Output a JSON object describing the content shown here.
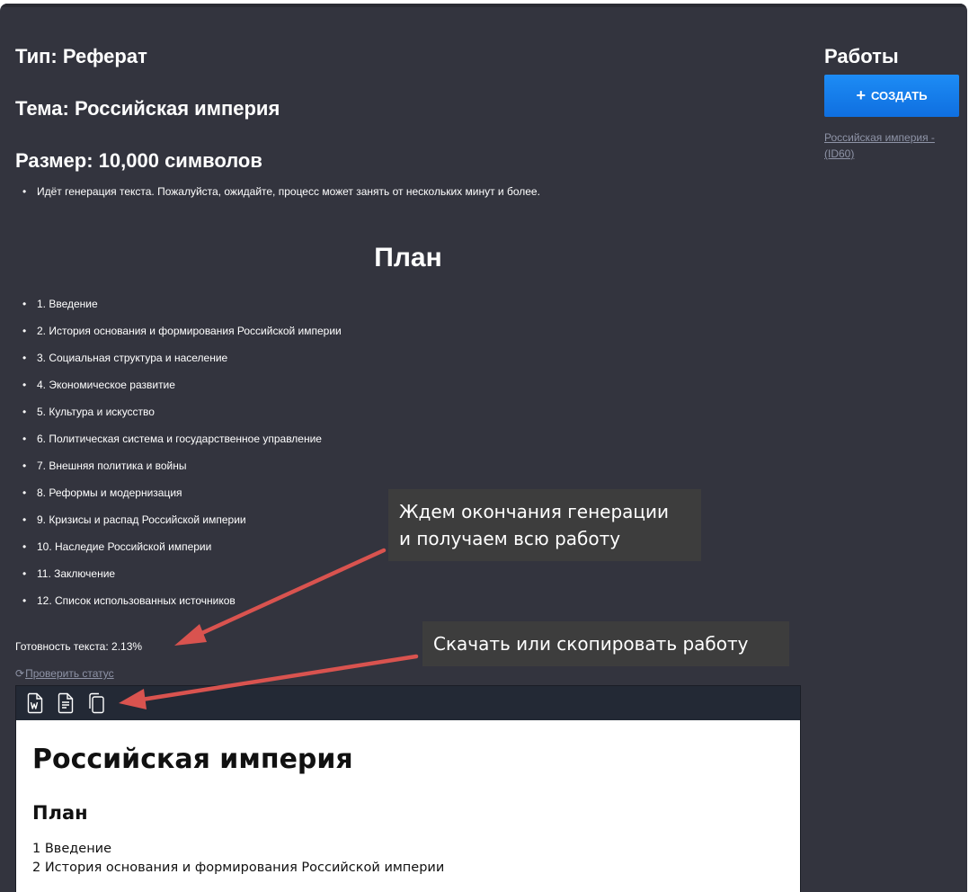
{
  "main": {
    "type_heading": "Тип: Реферат",
    "topic_heading": "Тема: Российская империя",
    "size_heading": "Размер: 10,000 символов",
    "notice": "Идёт генерация текста. Пожалуйста, ожидайте, процесс может занять от нескольких минут и более.",
    "plan_heading": "План",
    "plan_items": [
      "1. Введение",
      "2. История основания и формирования Российской империи",
      "3. Социальная структура и население",
      "4. Экономическое развитие",
      "5. Культура и искусство",
      "6. Политическая система и государственное управление",
      "7. Внешняя политика и войны",
      "8. Реформы и модернизация",
      "9. Кризисы и распад Российской империи",
      "10. Наследие Российской империи",
      "11. Заключение",
      "12. Список использованных источников"
    ],
    "readiness": "Готовность текста: 2.13%",
    "check_status": "Проверить статус",
    "toolbar": {
      "icons": [
        "word-download-icon",
        "document-download-icon",
        "copy-icon"
      ]
    },
    "document": {
      "title": "Российская империя",
      "plan_heading": "План",
      "lines": [
        "1 Введение",
        "2 История основания и формирования Российской империи"
      ]
    }
  },
  "sidebar": {
    "title": "Работы",
    "create_button": "СОЗДАТЬ",
    "works": [
      "Российская империя - (ID60)"
    ]
  },
  "annotations": {
    "callout_1": [
      "Ждем окончания генерации",
      "и получаем всю работу"
    ],
    "callout_2": "Скачать или скопировать работу"
  },
  "colors": {
    "background": "#33343e",
    "accent": "#1479ea",
    "arrow": "#d9534f",
    "link": "#8e93a6"
  }
}
